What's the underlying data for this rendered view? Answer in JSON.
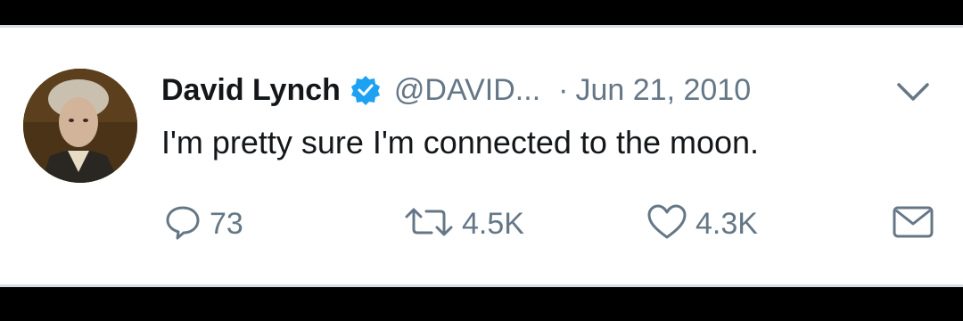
{
  "tweet": {
    "author_name": "David Lynch",
    "handle": "@DAVID...",
    "separator": "·",
    "date": "Jun 21, 2010",
    "text": "I'm pretty sure I'm connected to the moon.",
    "verified": true
  },
  "actions": {
    "reply_count": "73",
    "retweet_count": "4.5K",
    "like_count": "4.3K"
  },
  "icons": {
    "reply": "speech-bubble-icon",
    "retweet": "retweet-icon",
    "like": "heart-icon",
    "dm": "envelope-icon",
    "menu": "chevron-down-icon",
    "verified": "verified-badge-icon"
  },
  "colors": {
    "text_primary": "#14171a",
    "text_secondary": "#657786",
    "verified_blue": "#1da1f2",
    "background": "#ffffff"
  }
}
